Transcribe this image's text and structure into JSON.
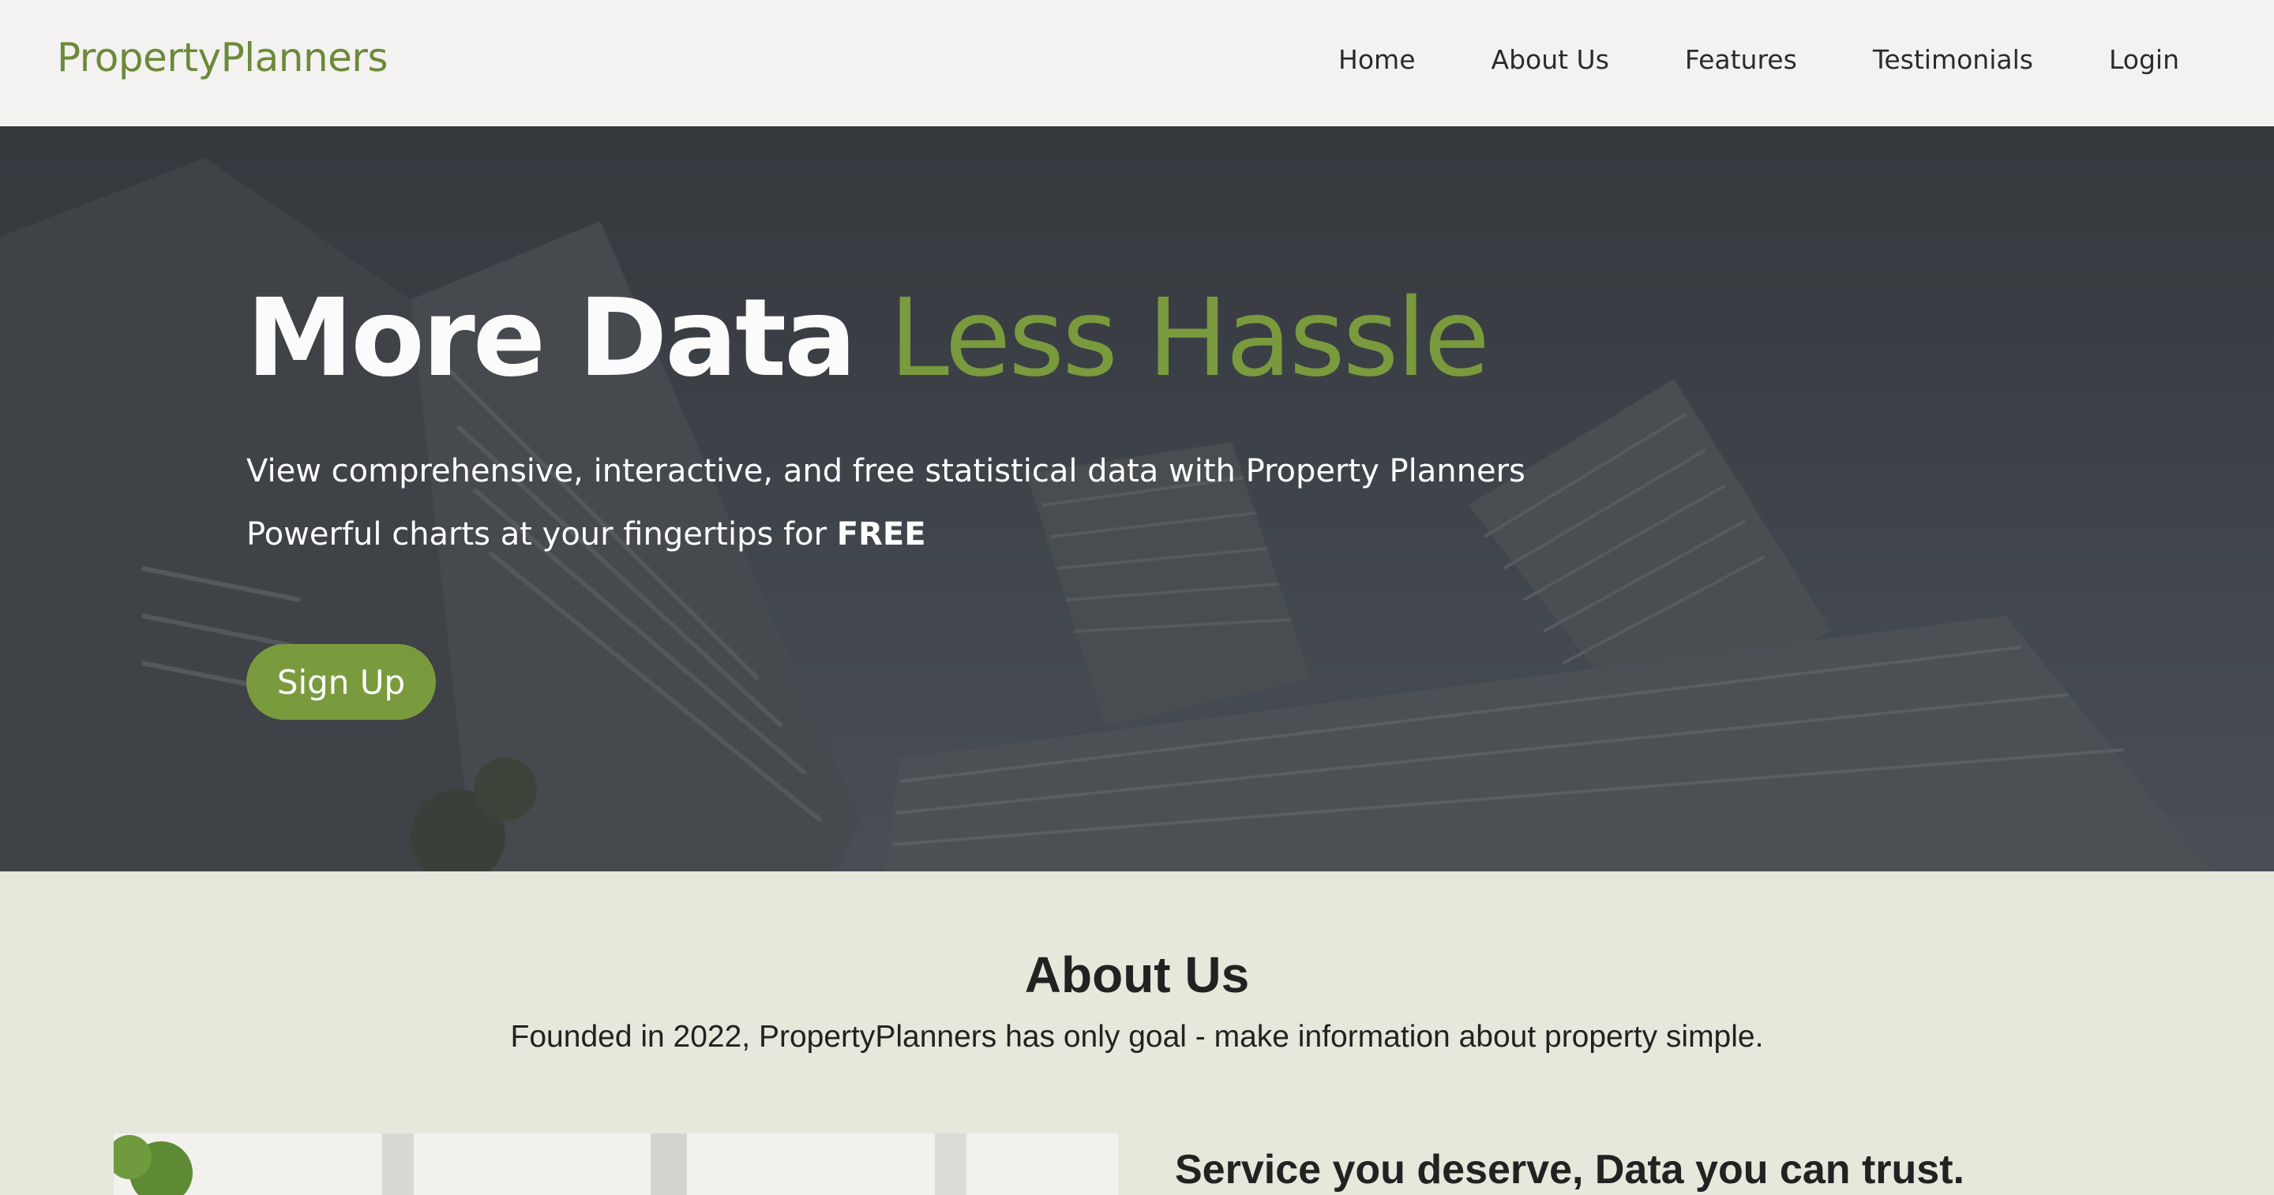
{
  "nav": {
    "logo": "PropertyPlanners",
    "items": [
      {
        "label": "Home"
      },
      {
        "label": "About Us"
      },
      {
        "label": "Features"
      },
      {
        "label": "Testimonials"
      },
      {
        "label": "Login"
      }
    ]
  },
  "hero": {
    "title_primary": "More Data",
    "title_accent": "Less Hassle",
    "line1": "View comprehensive, interactive, and free statistical data with Property Planners",
    "line2_prefix": "Powerful charts at your fingertips for",
    "line2_bold": "FREE",
    "signup_label": "Sign Up"
  },
  "about": {
    "heading": "About Us",
    "tagline": "Founded in 2022, PropertyPlanners has only goal - make information about property simple.",
    "subheading": "Service you deserve, Data you can trust."
  },
  "colors": {
    "accent": "#7a9a3e",
    "nav_bg": "#f3f2f0",
    "about_bg": "#e5e8da",
    "hero_overlay": "#3b3f43"
  }
}
